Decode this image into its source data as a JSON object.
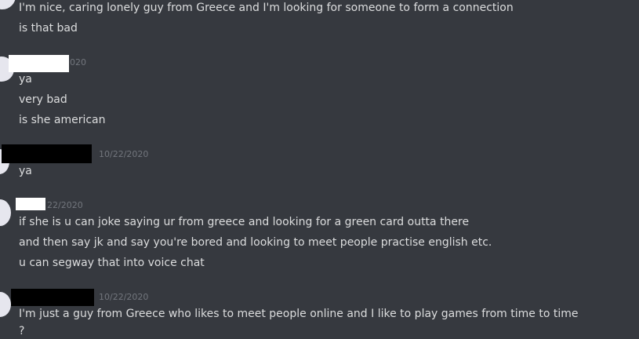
{
  "colors": {
    "background": "#36393f",
    "text": "#dcddde",
    "timestamp": "#72767d",
    "redaction_white": "#ffffff",
    "redaction_black": "#000000"
  },
  "messages": [
    {
      "timestamp": "",
      "lines": [
        "I'm nice, caring lonely guy from Greece and I'm looking for someone to form a connection",
        "is that bad"
      ]
    },
    {
      "timestamp": "020",
      "lines": [
        "ya",
        "very bad",
        "is she american"
      ]
    },
    {
      "timestamp": "10/22/2020",
      "lines": [
        "ya"
      ]
    },
    {
      "timestamp": "22/2020",
      "lines": [
        "if she is u can joke saying ur from greece and looking for  a green card outta there",
        "and then say jk and say you're bored and looking to meet people practise english etc.",
        "u can segway that into voice chat"
      ]
    },
    {
      "timestamp": "10/22/2020",
      "lines": [
        "I'm just a guy from Greece who likes to meet people online and I like to play games from time to time",
        "?"
      ]
    }
  ]
}
